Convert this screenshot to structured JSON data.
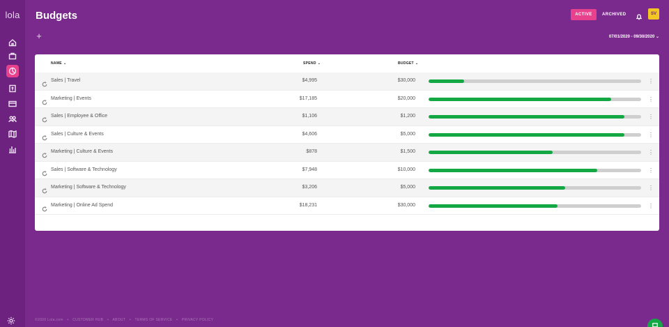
{
  "app": {
    "logo": "lola"
  },
  "header": {
    "title": "Budgets",
    "active_label": "ACTIVE",
    "archived_label": "ARCHIVED",
    "avatar_initials": "SV",
    "date_range": "07/01/2020 - 09/30/2020",
    "add_symbol": "+"
  },
  "sidebar": {
    "items": [
      {
        "icon": "home-icon"
      },
      {
        "icon": "briefcase-icon"
      },
      {
        "icon": "budgets-icon",
        "active": true
      },
      {
        "icon": "receipt-icon"
      },
      {
        "icon": "card-icon"
      },
      {
        "icon": "users-icon"
      },
      {
        "icon": "map-icon"
      },
      {
        "icon": "reports-icon"
      }
    ],
    "settings_icon": "gear-icon"
  },
  "table": {
    "columns": {
      "name": "NAME",
      "spend": "SPEND",
      "budget": "BUDGET"
    },
    "rows": [
      {
        "name": "Sales | Travel",
        "spend": "$4,995",
        "budget": "$30,000",
        "progress": 0.166
      },
      {
        "name": "Marketing | Events",
        "spend": "$17,185",
        "budget": "$20,000",
        "progress": 0.859
      },
      {
        "name": "Sales | Employee & Office",
        "spend": "$1,106",
        "budget": "$1,200",
        "progress": 0.922
      },
      {
        "name": "Sales | Culture & Events",
        "spend": "$4,606",
        "budget": "$5,000",
        "progress": 0.921
      },
      {
        "name": "Marketing | Culture & Events",
        "spend": "$878",
        "budget": "$1,500",
        "progress": 0.585
      },
      {
        "name": "Sales | Software & Technology",
        "spend": "$7,948",
        "budget": "$10,000",
        "progress": 0.795
      },
      {
        "name": "Marketing | Software & Technology",
        "spend": "$3,206",
        "budget": "$5,000",
        "progress": 0.641
      },
      {
        "name": "Marketing | Online Ad Spend",
        "spend": "$18,231",
        "budget": "$30,000",
        "progress": 0.608
      }
    ]
  },
  "footer": {
    "copyright": "©2020 Lola.com",
    "links": [
      "CUSTOMER HUB",
      "ABOUT",
      "TERMS OF SERVICE",
      "PRIVACY POLICY"
    ]
  },
  "colors": {
    "background": "#7a2a8c",
    "accent": "#e8418d",
    "progress": "#14a845",
    "avatar": "#f3c623"
  }
}
